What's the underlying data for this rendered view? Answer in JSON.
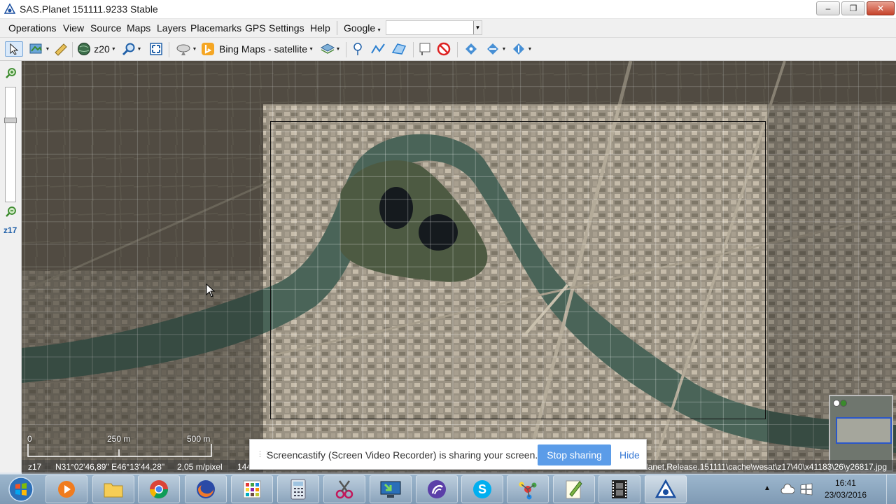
{
  "window": {
    "title": "SAS.Planet 151111.9233 Stable",
    "controls": [
      "minimize",
      "maximize",
      "close"
    ]
  },
  "menu": {
    "items": [
      "Operations",
      "View",
      "Source",
      "Maps",
      "Layers",
      "Placemarks",
      "GPS",
      "Settings",
      "Help"
    ],
    "search_provider": "Google",
    "search_value": ""
  },
  "toolbar": {
    "zoom_level": "z20",
    "map_source": "Bing Maps - satellite",
    "icons": [
      "select-cursor-icon",
      "layers-icon",
      "ruler-icon",
      "globe-icon",
      "magnifier-icon",
      "fullscreen-icon",
      "satellite-dish-icon",
      "bing-logo-icon",
      "layers-stack-icon",
      "placemark-icon",
      "path-icon",
      "polygon-icon",
      "marks-icon",
      "no-marks-icon",
      "gps-icon",
      "gps-track-icon",
      "gps-center-icon"
    ]
  },
  "zoom_panel": {
    "level_label": "z17",
    "zoom_in": "zoom-in-icon",
    "zoom_out": "zoom-out-icon",
    "slider_level": 0.28
  },
  "map": {
    "scale_labels": [
      "0",
      "250 m",
      "500 m"
    ]
  },
  "status": {
    "zoom": "z17",
    "coords": "N31°02'46,89\" E46°13'44,28\"",
    "resolution": "2,05 m/pixel",
    "partial": "144",
    "path": "lanet.Release.151111\\cache\\wesat\\z17\\40\\x41183\\26\\y26817.jpg"
  },
  "banner": {
    "message": "Screencastify (Screen Video Recorder) is sharing your screen.",
    "stop_label": "Stop sharing",
    "hide_label": "Hide"
  },
  "taskbar": {
    "apps": [
      "media-player-icon",
      "explorer-icon",
      "chrome-icon",
      "firefox-icon",
      "app-grid-icon",
      "calculator-icon",
      "scissors-icon",
      "desktop-remote-icon",
      "torrent-icon",
      "skype-icon",
      "molecule-icon",
      "edit-icon",
      "film-icon",
      "sas-planet-icon"
    ],
    "time": "16:41",
    "date": "23/03/2016"
  },
  "colors": {
    "accent": "#5b9ce8",
    "river": "#4a6458",
    "selection": "#111111"
  }
}
